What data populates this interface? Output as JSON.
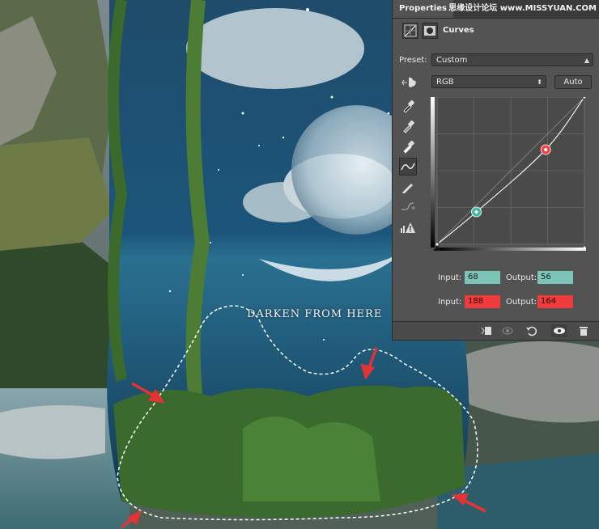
{
  "panel": {
    "tab_label": "Properties",
    "watermark": "思缘设计论坛 www.MISSYUAN.COM",
    "adjustment_title": "Curves",
    "preset_label": "Preset:",
    "preset_value": "Custom",
    "channel_value": "RGB",
    "auto_label": "Auto",
    "points": [
      {
        "input_label": "Input:",
        "input": "68",
        "output_label": "Output:",
        "output": "56",
        "color": "#7ac5b8"
      },
      {
        "input_label": "Input:",
        "input": "188",
        "output_label": "Output:",
        "output": "164",
        "color": "#ef3b3b"
      }
    ],
    "tools": [
      "point-eyedropper-black-icon",
      "point-eyedropper-gray-icon",
      "point-eyedropper-white-icon",
      "curve-point-tool-icon",
      "pencil-tool-icon",
      "smooth-curve-icon",
      "clipping-warning-icon"
    ],
    "footer_icons": [
      "clip-to-layer-icon",
      "view-previous-icon",
      "reset-icon",
      "visibility-eye-icon",
      "trash-icon"
    ]
  },
  "canvas": {
    "caption": "DARKEN FROM HERE"
  },
  "colors": {
    "panel_bg": "#535353",
    "accent_teal": "#7ac5b8",
    "accent_red": "#ef3b3b"
  }
}
